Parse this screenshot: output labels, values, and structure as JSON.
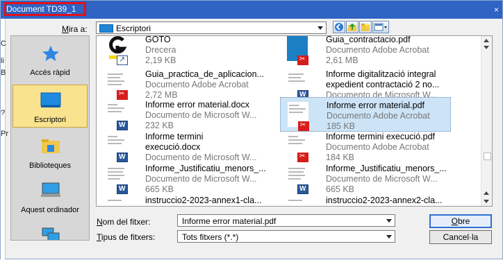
{
  "window": {
    "title": "Document TD39_1",
    "close_label": "×"
  },
  "left_strip": [
    "C",
    "li",
    "B",
    "?",
    "Pr"
  ],
  "look_in": {
    "label_prefix": "M",
    "label_rest": "ira a:",
    "value": "Escriptori"
  },
  "toolbar": {
    "icons": [
      "back-icon",
      "up-folder-icon",
      "new-folder-icon",
      "view-menu-icon"
    ]
  },
  "places": [
    {
      "label": "Accés ràpid",
      "icon": "star-icon",
      "selected": false
    },
    {
      "label": "Escriptori",
      "icon": "desktop-icon",
      "selected": true
    },
    {
      "label": "Biblioteques",
      "icon": "folder-icon",
      "selected": false
    },
    {
      "label": "Aquest ordinador",
      "icon": "computer-icon",
      "selected": false
    },
    {
      "label": "",
      "icon": "network-icon",
      "selected": false
    }
  ],
  "files": [
    {
      "name1": "GOTO",
      "name2": "",
      "type": "Drecera",
      "size": "2,19 KB",
      "icon": "shortcut",
      "selected": false
    },
    {
      "name1": "Guia_contractacio.pdf",
      "name2": "",
      "type": "Documento Adobe Acrobat",
      "size": "2,61 MB",
      "icon": "pdf",
      "selected": false
    },
    {
      "name1": "Guia_practica_de_aplicacion...",
      "name2": "",
      "type": "Documento Adobe Acrobat",
      "size": "2,72 MB",
      "icon": "pdf",
      "selected": false
    },
    {
      "name1": "Informe digitalització integral",
      "name2": "expedient contractació 2 no...",
      "type": "Documento de Microsoft W...",
      "size": "",
      "icon": "word",
      "selected": false
    },
    {
      "name1": "Informe error material.docx",
      "name2": "",
      "type": "Documento de Microsoft W...",
      "size": "232 KB",
      "icon": "word",
      "selected": false
    },
    {
      "name1": "Informe error material.pdf",
      "name2": "",
      "type": "Documento Adobe Acrobat",
      "size": "185 KB",
      "icon": "pdf",
      "selected": true
    },
    {
      "name1": "Informe termini",
      "name2": "execució.docx",
      "type": "Documento de Microsoft W...",
      "size": "",
      "icon": "word",
      "selected": false
    },
    {
      "name1": "Informe termini execució.pdf",
      "name2": "",
      "type": "Documento Adobe Acrobat",
      "size": "184 KB",
      "icon": "pdf",
      "selected": false
    },
    {
      "name1": "Informe_Justificatiu_menors_...",
      "name2": "",
      "type": "Documento de Microsoft W...",
      "size": "665 KB",
      "icon": "word",
      "selected": false
    },
    {
      "name1": "Informe_Justificatiu_menors_...",
      "name2": "",
      "type": "Documento de Microsoft W...",
      "size": "665 KB",
      "icon": "word",
      "selected": false
    },
    {
      "name1": "instruccio2-2023-annex1-cla...",
      "name2": "",
      "type": "",
      "size": "",
      "icon": "doc",
      "selected": false
    },
    {
      "name1": "instruccio2-2023-annex2-cla...",
      "name2": "",
      "type": "",
      "size": "",
      "icon": "doc",
      "selected": false
    }
  ],
  "file_name": {
    "label_prefix": "N",
    "label_rest": "om del fitxer:",
    "value": "Informe error material.pdf"
  },
  "file_type": {
    "label_prefix": "T",
    "label_rest": "ipus de fitxers:",
    "value": "Tots fitxers (*.*)"
  },
  "buttons": {
    "open_prefix": "O",
    "open_rest": "bre",
    "cancel_label": "Cancel·la"
  },
  "colors": {
    "title_bar": "#2f63c4",
    "highlight_box": "#e3101b",
    "selection": "#cde4f7",
    "place_selected": "#f9e38f"
  }
}
